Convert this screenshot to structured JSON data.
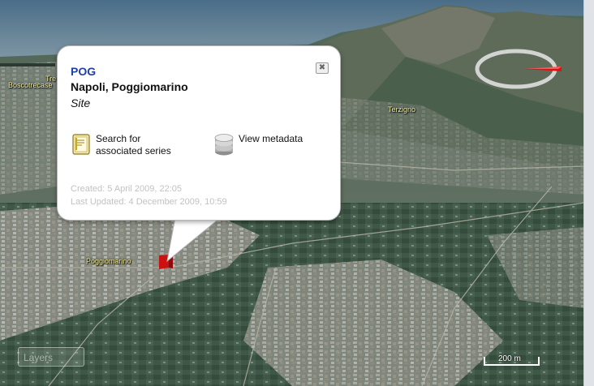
{
  "map": {
    "places": [
      {
        "name": "Boscotrecase"
      },
      {
        "name": "Tre"
      },
      {
        "name": "Terzigno"
      },
      {
        "name": "Poggiomarino"
      }
    ],
    "scale_label": "200 m",
    "layers_label": "Layers"
  },
  "balloon": {
    "code": "POG",
    "site_name": "Napoli, Poggiomarino",
    "site_type": "Site",
    "close_glyph": "✖",
    "actions": [
      {
        "label": "Search for associated series",
        "icon": "document-search-icon"
      },
      {
        "label": "View metadata",
        "icon": "database-icon"
      }
    ],
    "created": "Created: 5 April 2009, 22:05",
    "updated": "Last Updated: 4 December 2009, 10:59"
  },
  "colors": {
    "code_text": "#1f3fa3",
    "marker": "#cc1111",
    "compass_needle": "#dd1111"
  }
}
